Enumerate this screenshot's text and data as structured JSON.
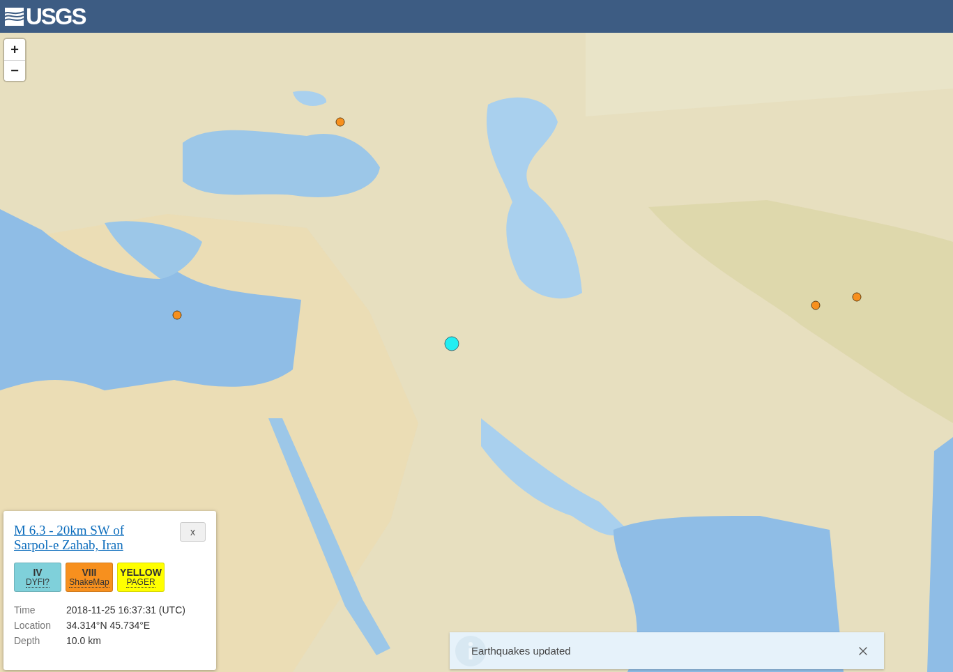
{
  "header": {
    "logo_text": "USGS"
  },
  "zoom_controls": [
    {
      "label": "+"
    },
    {
      "label": "−"
    }
  ],
  "earthquakes": [
    {
      "selected": false
    },
    {
      "selected": false
    },
    {
      "selected": false
    },
    {
      "selected": false
    },
    {
      "selected": true
    }
  ],
  "event_popup": {
    "title": "M 6.3 - 20km SW of Sarpol-e Zahab, Iran",
    "close_label": "x",
    "summaries": [
      {
        "value": "IV",
        "label": "DYFI?",
        "color": "#7fd0da"
      },
      {
        "value": "VIII",
        "label": "ShakeMap",
        "color": "#f7901e"
      },
      {
        "value": "YELLOW",
        "label": "PAGER",
        "color": "#ffff00"
      }
    ],
    "details": [
      {
        "label": "Time",
        "value": "2018-11-25 16:37:31 (UTC)"
      },
      {
        "label": "Location",
        "value": "34.314°N 45.734°E"
      },
      {
        "label": "Depth",
        "value": "10.0 km"
      }
    ]
  },
  "toast": {
    "message": "Earthquakes updated"
  }
}
